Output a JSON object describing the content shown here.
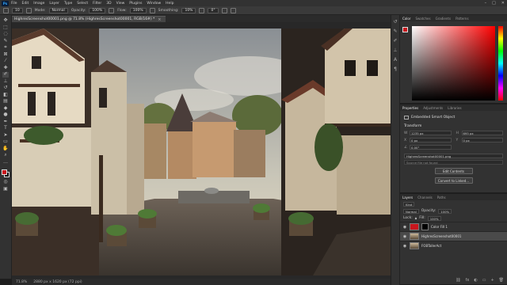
{
  "app": {
    "logo": "Ps"
  },
  "menu": [
    "File",
    "Edit",
    "Image",
    "Layer",
    "Type",
    "Select",
    "Filter",
    "3D",
    "View",
    "Plugins",
    "Window",
    "Help"
  ],
  "options_bar": {
    "brush_size": "10",
    "mode_label": "Mode:",
    "mode_value": "Normal",
    "opacity_label": "Opacity:",
    "opacity_value": "100%",
    "flow_label": "Flow:",
    "flow_value": "100%",
    "smoothing_label": "Smoothing:",
    "smoothing_value": "10%",
    "angle_value": "0°"
  },
  "document_tab": {
    "title": "HighresScreenshot00001.png @ 71.8% (HighresScreenshot00001, RGB/16#) *"
  },
  "status": {
    "zoom": "71.8%",
    "doc_size": "2880 px x 1620 px (72 ppi)"
  },
  "color_panel": {
    "tabs": [
      "Color",
      "Swatches",
      "Gradients",
      "Patterns"
    ],
    "fg_color": "#c8161d",
    "bg_color": "#000000"
  },
  "properties_panel": {
    "tabs": [
      "Properties",
      "Adjustments",
      "Libraries"
    ],
    "layer_type": "Embedded Smart Object",
    "section": "Transform",
    "fields": [
      {
        "key": "W",
        "value": "1235 px"
      },
      {
        "key": "H",
        "value": "695 px"
      },
      {
        "key": "X",
        "value": "0 px"
      },
      {
        "key": "Y",
        "value": "0 px"
      },
      {
        "key": "∠",
        "value": "0.00°"
      }
    ],
    "file_name": "HighresScreenshot00001.png",
    "file_sub": "Source file not found",
    "edit_btn": "Edit Contents",
    "convert_btn": "Convert to Linked..."
  },
  "layers_panel": {
    "tabs": [
      "Layers",
      "Channels",
      "Paths"
    ],
    "kind_label": "Kind",
    "blend_mode": "Normal",
    "opacity_label": "Opacity:",
    "opacity_value": "100%",
    "lock_label": "Lock:",
    "fill_label": "Fill:",
    "fill_value": "100%",
    "layers": [
      {
        "name": "Color Fill 1",
        "type": "fill",
        "selected": false
      },
      {
        "name": "HighresScreenshot00001",
        "type": "image",
        "selected": true
      },
      {
        "name": "FOBTallerAct",
        "type": "image",
        "selected": false
      }
    ]
  },
  "watermark": "Udemy"
}
